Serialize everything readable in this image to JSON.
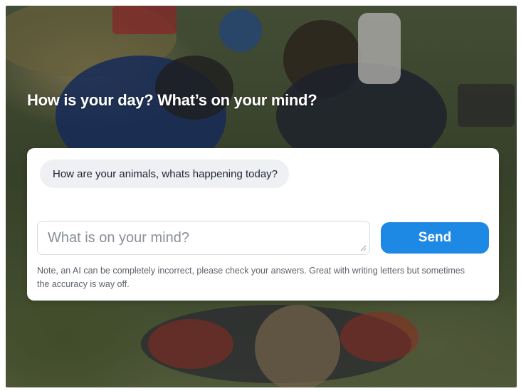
{
  "background": {
    "description_icon": "photo-background"
  },
  "headline": "How is your day? What’s on your mind?",
  "chat": {
    "bot_message": "How are your animals, whats happening today?"
  },
  "composer": {
    "placeholder": "What is on your mind?",
    "value": "",
    "send_label": "Send",
    "accent": "#1e88e5"
  },
  "note": "Note, an AI can be completely incorrect, please check your answers. Great with writing letters but sometimes the accuracy is way off."
}
